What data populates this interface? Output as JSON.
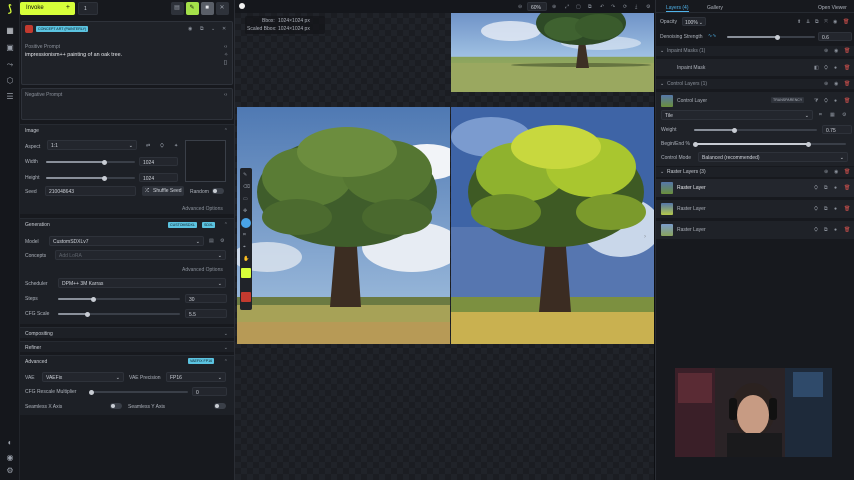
{
  "app": {
    "brand_color": "#d7ff3a",
    "invoke_label": "Invoke",
    "batch_count": "1"
  },
  "prompts": {
    "positive_label": "Positive Prompt",
    "positive_value": "impressionism++ painting of an oak tree.",
    "negative_label": "Negative Prompt",
    "style_preset": "CONCEPT ART (PAINTERLY)"
  },
  "image": {
    "title": "Image",
    "aspect_label": "Aspect",
    "aspect_value": "1:1",
    "width_label": "Width",
    "width_value": "1024",
    "height_label": "Height",
    "height_value": "1024",
    "seed_label": "Seed",
    "seed_value": "210048643",
    "shuffle_label": "Shuffle Seed",
    "random_label": "Random",
    "advanced_label": "Advanced Options"
  },
  "generation": {
    "title": "Generation",
    "badge1": "CUSTOMSDXL",
    "badge2": "SDXL",
    "model_label": "Model",
    "model_value": "CustomSDXLv7",
    "concepts_label": "Concepts",
    "concepts_placeholder": "Add LoRA",
    "advanced_label": "Advanced Options",
    "scheduler_label": "Scheduler",
    "scheduler_value": "DPM++ 3M Karras",
    "steps_label": "Steps",
    "steps_value": "30",
    "cfg_label": "CFG Scale",
    "cfg_value": "5.5"
  },
  "compositing": {
    "title": "Compositing"
  },
  "refiner": {
    "title": "Refiner"
  },
  "advanced": {
    "title": "Advanced",
    "badge": "VAEFIX FP16",
    "vae_label": "VAE",
    "vae_value": "VAEFix",
    "vae_precision_label": "VAE Precision",
    "vae_precision_value": "FP16",
    "cfg_rescale_label": "CFG Rescale Multiplier",
    "cfg_rescale_value": "0",
    "seamless_x_label": "Seamless X Axis",
    "seamless_y_label": "Seamless Y Axis"
  },
  "canvas": {
    "zoom": "60%",
    "bbox_label": "Bbox:",
    "bbox_value": "1024×1024 px",
    "scaled_label": "Scaled Bbox:",
    "scaled_value": "1024×1024 px"
  },
  "right": {
    "tab_layers": "Layers (4)",
    "tab_gallery": "Gallery",
    "open_viewer": "Open Viewer",
    "opacity_label": "Opacity",
    "opacity_value": "100%",
    "denoise_label": "Denoising Strength",
    "denoise_value": "0.6",
    "inpaint_masks_title": "Inpaint Masks (1)",
    "inpaint_mask_item": "Inpaint Mask",
    "control_layers_title": "Control Layers (1)",
    "control_layer_item": "Control Layer",
    "transparency_badge": "TRANSPARENCY",
    "control_model_value": "Tile",
    "weight_label": "Weight",
    "weight_value": "0.75",
    "begin_end_label": "Begin/End %",
    "control_mode_label": "Control Mode",
    "control_mode_value": "Balanced (recommended)",
    "raster_layers_title": "Raster Layers (3)",
    "raster_items": [
      "Raster Layer",
      "Raster Layer",
      "Raster Layer"
    ]
  },
  "icons": [
    "canvas-icon",
    "layers-icon",
    "workflow-icon",
    "model-icon",
    "queue-icon",
    "info-icon",
    "discord-icon",
    "settings-icon"
  ]
}
